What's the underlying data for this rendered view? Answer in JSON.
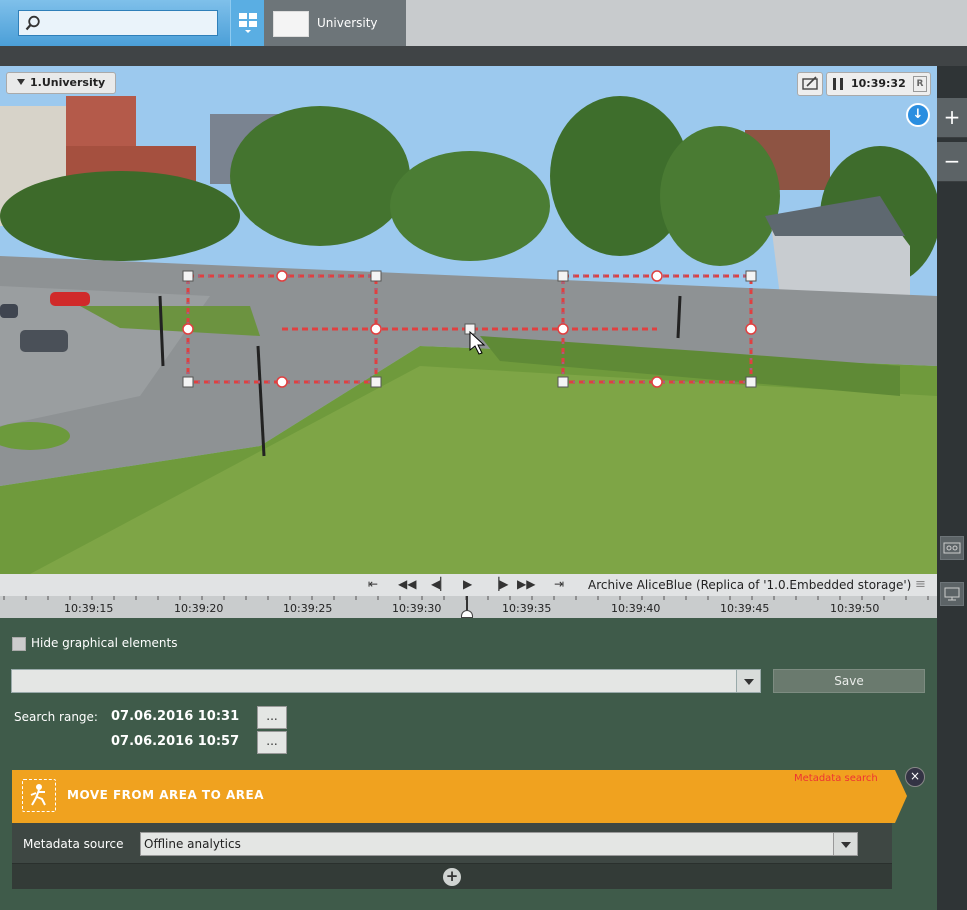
{
  "search": {
    "placeholder": "",
    "value": ""
  },
  "layout_tab": {
    "label": "University"
  },
  "camera": {
    "label": "1.University",
    "time": "10:39:32",
    "mode_badge": "R"
  },
  "side_controls": {
    "zoom_in": "+",
    "zoom_out": "−"
  },
  "playback": {
    "archive_text": "Archive AliceBlue (Replica of '1.0.Embedded storage')",
    "menu_glyph": "≡"
  },
  "timeline": {
    "ticks": [
      "10:39:15",
      "10:39:20",
      "10:39:25",
      "10:39:30",
      "10:39:35",
      "10:39:40",
      "10:39:45",
      "10:39:50"
    ]
  },
  "panel": {
    "hide_elements_label": "Hide graphical elements",
    "query_value": "",
    "save_label": "Save",
    "search_range_label": "Search range:",
    "range_start": "07.06.2016  10:31",
    "range_end": "07.06.2016  10:57",
    "dots_label": "..."
  },
  "detector": {
    "title": "MOVE FROM AREA TO AREA",
    "metadata_link": "Metadata search",
    "close_glyph": "×",
    "metadata_source_label": "Metadata source",
    "metadata_source_value": "Offline analytics",
    "add_glyph": "+"
  },
  "colors": {
    "accent_blue": "#4b9fd8",
    "detector_orange": "#f0a21f",
    "panel_green": "#3f5b4a",
    "zone_red": "#e04040"
  }
}
